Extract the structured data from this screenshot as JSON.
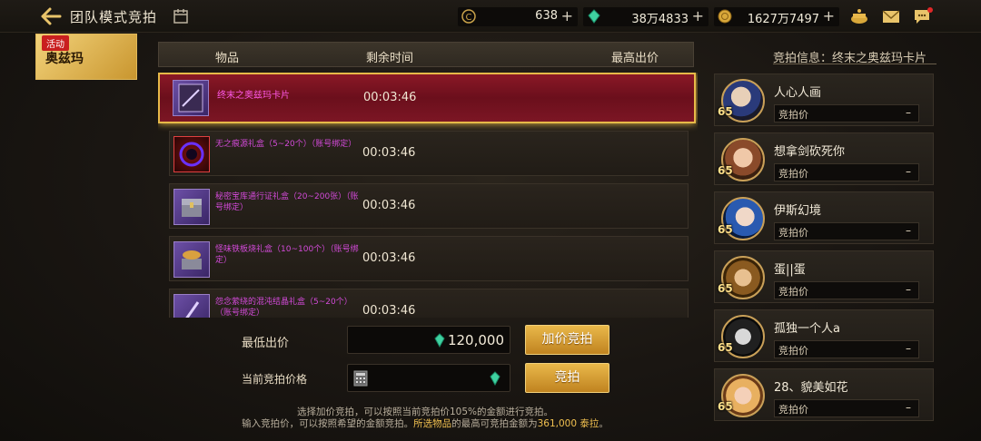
{
  "header": {
    "title": "团队模式竞拍",
    "currencies": [
      {
        "icon": "coin-c-icon",
        "amount": "638"
      },
      {
        "icon": "gem-icon",
        "amount": "38万4833"
      },
      {
        "icon": "gold-coin-icon",
        "amount": "1627万7497"
      }
    ],
    "plus": "+"
  },
  "activity": {
    "tag": "活动",
    "name": "奥兹玛"
  },
  "table": {
    "headers": {
      "item": "物品",
      "time": "剩余时间",
      "top_bid": "最高出价"
    },
    "rows": [
      {
        "name": "终末之奥兹玛卡片",
        "time": "00:03:46"
      },
      {
        "name": "无之痕源礼盒（5~20个）（账号绑定）",
        "time": "00:03:46"
      },
      {
        "name": "秘密宝库通行证礼盒（20~200张）（账号绑定）",
        "time": "00:03:46"
      },
      {
        "name": "怪味铁板烧礼盒（10~100个）（账号绑定）",
        "time": "00:03:46"
      },
      {
        "name": "怨念萦绕的混沌结晶礼盒（5~20个）（账号绑定）",
        "time": "00:03:46"
      }
    ]
  },
  "bid": {
    "min_label": "最低出价",
    "min_value": "120,000",
    "current_label": "当前竞拍价格",
    "current_value": "",
    "raise_button": "加价竞拍",
    "bid_button": "竞拍",
    "note_line1": "选择加价竞拍，可以按照当前竞拍价105%的金额进行竞拍。",
    "note_line2_a": "输入竞拍价，可以按照希望的金额竞拍。",
    "note_line2_b": "所选物品",
    "note_line2_c": "的最高可竞拍金额为",
    "note_line2_d": "361,000 泰拉",
    "note_line2_e": "。"
  },
  "info": {
    "title": "竞拍信息：终末之奥兹玛卡片",
    "price_label": "竞拍价",
    "empty_price": "–",
    "bidders": [
      {
        "name": "人心人画",
        "level": "65"
      },
      {
        "name": "想拿剑砍死你",
        "level": "65"
      },
      {
        "name": "伊斯幻境",
        "level": "65"
      },
      {
        "name": "蛋||蛋",
        "level": "65"
      },
      {
        "name": "孤独一个人a",
        "level": "65"
      },
      {
        "name": "28、貌美如花",
        "level": "65"
      }
    ]
  },
  "colors": {
    "accent_gold": "#e9b84a",
    "selected_row": "#8a1826",
    "item_purple": "#d24ad8"
  }
}
